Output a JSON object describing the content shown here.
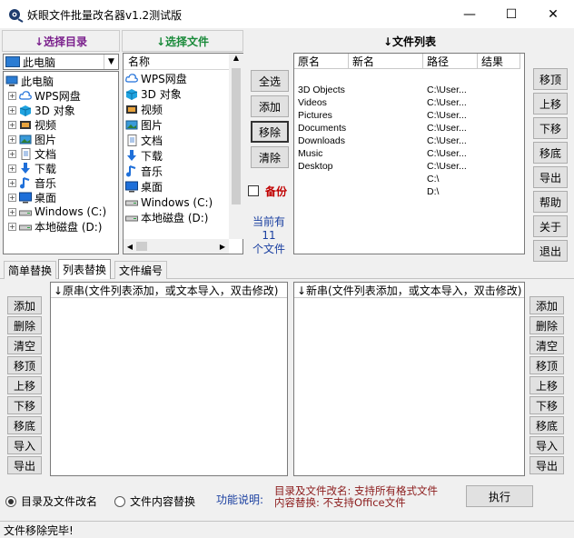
{
  "window": {
    "title": "妖眼文件批量改名器v1.2测试版",
    "min_glyph": "—",
    "max_glyph": "☐",
    "close_glyph": "✕"
  },
  "dir_panel": {
    "header": "↓选择目录",
    "combo_value": "此电脑",
    "tree": [
      {
        "label": "此电脑",
        "icon": "computer-icon",
        "expand": false
      },
      {
        "label": "WPS网盘",
        "icon": "cloud-icon",
        "expand": true
      },
      {
        "label": "3D 对象",
        "icon": "cube-icon",
        "expand": true
      },
      {
        "label": "视频",
        "icon": "video-icon",
        "expand": true
      },
      {
        "label": "图片",
        "icon": "picture-icon",
        "expand": true
      },
      {
        "label": "文档",
        "icon": "document-icon",
        "expand": true
      },
      {
        "label": "下载",
        "icon": "download-icon",
        "expand": true
      },
      {
        "label": "音乐",
        "icon": "music-icon",
        "expand": true
      },
      {
        "label": "桌面",
        "icon": "desktop-icon",
        "expand": true
      },
      {
        "label": "Windows (C:)",
        "icon": "drive-icon",
        "expand": true
      },
      {
        "label": "本地磁盘 (D:)",
        "icon": "drive-icon",
        "expand": true
      }
    ]
  },
  "file_panel": {
    "header": "↓选择文件",
    "col_name": "名称",
    "items": [
      {
        "label": "WPS网盘",
        "icon": "cloud-icon"
      },
      {
        "label": "3D 对象",
        "icon": "cube-icon"
      },
      {
        "label": "视频",
        "icon": "video-icon"
      },
      {
        "label": "图片",
        "icon": "picture-icon"
      },
      {
        "label": "文档",
        "icon": "document-icon"
      },
      {
        "label": "下载",
        "icon": "download-icon"
      },
      {
        "label": "音乐",
        "icon": "music-icon"
      },
      {
        "label": "桌面",
        "icon": "desktop-icon"
      },
      {
        "label": "Windows (C:)",
        "icon": "drive-icon"
      },
      {
        "label": "本地磁盘 (D:)",
        "icon": "drive-icon"
      }
    ]
  },
  "middle": {
    "select_all": "全选",
    "add": "添加",
    "remove": "移除",
    "clear": "清除",
    "backup_label": "备份",
    "count_line1": "当前有",
    "count_value": "11",
    "count_line2": "个文件"
  },
  "file_list": {
    "header": "↓文件列表",
    "columns": [
      "原名",
      "新名",
      "路径",
      "结果"
    ],
    "rows": [
      {
        "orig": "",
        "new": "",
        "path": "",
        "result": ""
      },
      {
        "orig": "3D Objects",
        "new": "",
        "path": "C:\\User...",
        "result": ""
      },
      {
        "orig": "Videos",
        "new": "",
        "path": "C:\\User...",
        "result": ""
      },
      {
        "orig": "Pictures",
        "new": "",
        "path": "C:\\User...",
        "result": ""
      },
      {
        "orig": "Documents",
        "new": "",
        "path": "C:\\User...",
        "result": ""
      },
      {
        "orig": "Downloads",
        "new": "",
        "path": "C:\\User...",
        "result": ""
      },
      {
        "orig": "Music",
        "new": "",
        "path": "C:\\User...",
        "result": ""
      },
      {
        "orig": "Desktop",
        "new": "",
        "path": "C:\\User...",
        "result": ""
      },
      {
        "orig": "",
        "new": "",
        "path": "C:\\",
        "result": ""
      },
      {
        "orig": "",
        "new": "",
        "path": "D:\\",
        "result": ""
      }
    ]
  },
  "right_buttons": [
    "移顶",
    "上移",
    "下移",
    "移底",
    "导出",
    "帮助",
    "关于",
    "退出"
  ],
  "tabs": [
    "简单替换",
    "列表替换",
    "文件编号"
  ],
  "left_list": {
    "header": "↓原串(文件列表添加，或文本导入，双击修改)",
    "buttons": [
      "添加",
      "删除",
      "清空",
      "移顶",
      "上移",
      "下移",
      "移底",
      "导入",
      "导出"
    ]
  },
  "right_list": {
    "header": "↓新串(文件列表添加，或文本导入，双击修改)",
    "buttons": [
      "添加",
      "删除",
      "清空",
      "移顶",
      "上移",
      "下移",
      "移底",
      "导入",
      "导出"
    ]
  },
  "bottom": {
    "radio1": "目录及文件改名",
    "radio2": "文件内容替换",
    "func_label": "功能说明:",
    "func_desc1": "目录及文件改名: 支持所有格式文件",
    "func_desc2": "内容替换: 不支持Office文件",
    "execute": "执行"
  },
  "status": "文件移除完毕!"
}
